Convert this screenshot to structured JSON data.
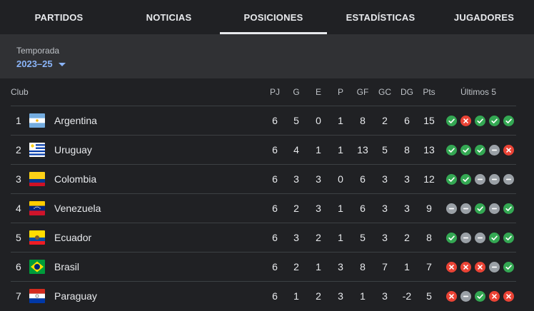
{
  "tabs": [
    {
      "label": "PARTIDOS",
      "active": false
    },
    {
      "label": "NOTICIAS",
      "active": false
    },
    {
      "label": "POSICIONES",
      "active": true
    },
    {
      "label": "ESTADÍSTICAS",
      "active": false
    },
    {
      "label": "JUGADORES",
      "active": false
    }
  ],
  "season": {
    "label": "Temporada",
    "value": "2023–25"
  },
  "table": {
    "headers": {
      "club": "Club",
      "pj": "PJ",
      "g": "G",
      "e": "E",
      "p": "P",
      "gf": "GF",
      "gc": "GC",
      "dg": "DG",
      "pts": "Pts",
      "last5": "Últimos 5"
    },
    "rows": [
      {
        "pos": "1",
        "team": "Argentina",
        "flag": "argentina",
        "pj": "6",
        "g": "5",
        "e": "0",
        "p": "1",
        "gf": "8",
        "gc": "2",
        "dg": "6",
        "pts": "15",
        "form": [
          "w",
          "l",
          "w",
          "w",
          "w"
        ]
      },
      {
        "pos": "2",
        "team": "Uruguay",
        "flag": "uruguay",
        "pj": "6",
        "g": "4",
        "e": "1",
        "p": "1",
        "gf": "13",
        "gc": "5",
        "dg": "8",
        "pts": "13",
        "form": [
          "w",
          "w",
          "w",
          "d",
          "l"
        ]
      },
      {
        "pos": "3",
        "team": "Colombia",
        "flag": "colombia",
        "pj": "6",
        "g": "3",
        "e": "3",
        "p": "0",
        "gf": "6",
        "gc": "3",
        "dg": "3",
        "pts": "12",
        "form": [
          "w",
          "w",
          "d",
          "d",
          "d"
        ]
      },
      {
        "pos": "4",
        "team": "Venezuela",
        "flag": "venezuela",
        "pj": "6",
        "g": "2",
        "e": "3",
        "p": "1",
        "gf": "6",
        "gc": "3",
        "dg": "3",
        "pts": "9",
        "form": [
          "d",
          "d",
          "w",
          "d",
          "w"
        ]
      },
      {
        "pos": "5",
        "team": "Ecuador",
        "flag": "ecuador",
        "pj": "6",
        "g": "3",
        "e": "2",
        "p": "1",
        "gf": "5",
        "gc": "3",
        "dg": "2",
        "pts": "8",
        "form": [
          "w",
          "d",
          "d",
          "w",
          "w"
        ]
      },
      {
        "pos": "6",
        "team": "Brasil",
        "flag": "brasil",
        "pj": "6",
        "g": "2",
        "e": "1",
        "p": "3",
        "gf": "8",
        "gc": "7",
        "dg": "1",
        "pts": "7",
        "form": [
          "l",
          "l",
          "l",
          "d",
          "w"
        ]
      },
      {
        "pos": "7",
        "team": "Paraguay",
        "flag": "paraguay",
        "pj": "6",
        "g": "1",
        "e": "2",
        "p": "3",
        "gf": "1",
        "gc": "3",
        "dg": "-2",
        "pts": "5",
        "form": [
          "l",
          "d",
          "w",
          "l",
          "l"
        ]
      }
    ]
  },
  "colors": {
    "win": "#34a853",
    "loss": "#ea4335",
    "draw": "#9aa0a6",
    "accent": "#8ab4f8",
    "background": "#202124",
    "panel": "#303134"
  }
}
